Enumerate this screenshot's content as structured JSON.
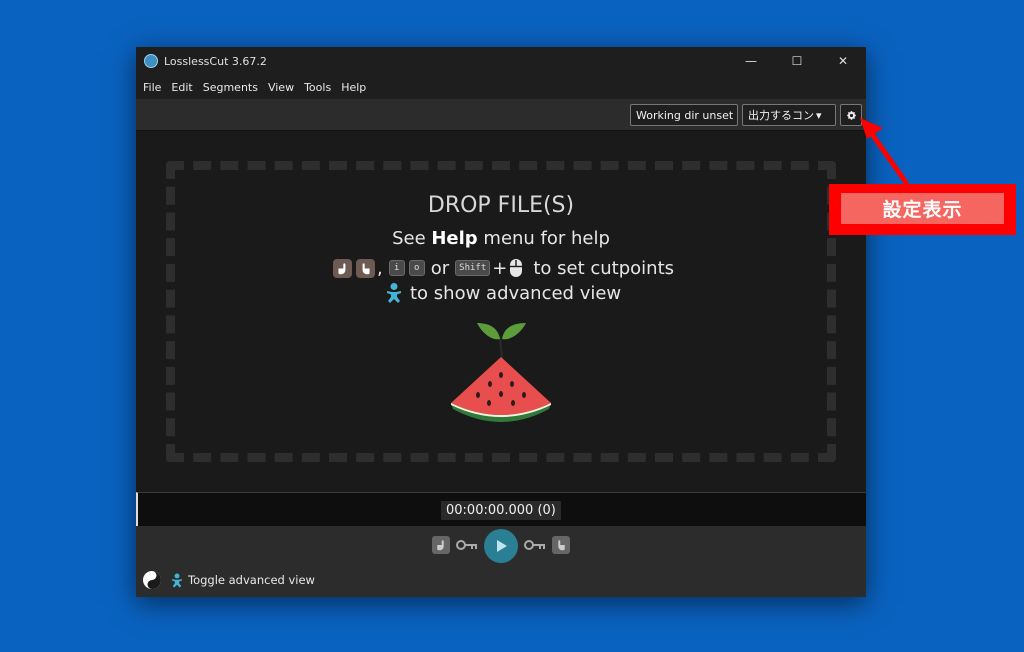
{
  "window": {
    "title": "LosslessCut 3.67.2",
    "controls": {
      "minimize": "—",
      "maximize": "☐",
      "close": "✕"
    }
  },
  "menu": [
    "File",
    "Edit",
    "Segments",
    "View",
    "Tools",
    "Help"
  ],
  "toolbar": {
    "working_dir": "Working dir unset",
    "output_format": "出力するコン",
    "dropdown_arrow": "▾",
    "settings_icon": "gear-icon"
  },
  "drop_area": {
    "title": "DROP FILE(S)",
    "help_prefix": "See ",
    "help_bold": "Help",
    "help_suffix": " menu for help",
    "key_i": "i",
    "key_o": "o",
    "key_shift": "Shift",
    "or": "or",
    "plus": "+",
    "comma": ",",
    "cutpoints_text": "to set cutpoints",
    "advanced_text": "to show advanced view"
  },
  "timeline": {
    "time": "00:00:00.000 (0)"
  },
  "status": {
    "toggle_label": "Toggle advanced view"
  },
  "annotation": {
    "label": "設定表示"
  },
  "colors": {
    "desktop": "#0a62c0",
    "accent_play": "#2a7f94",
    "annotation_red": "#ff0000",
    "annotation_fill": "#f4665f",
    "advanced_icon": "#46b4d6"
  }
}
